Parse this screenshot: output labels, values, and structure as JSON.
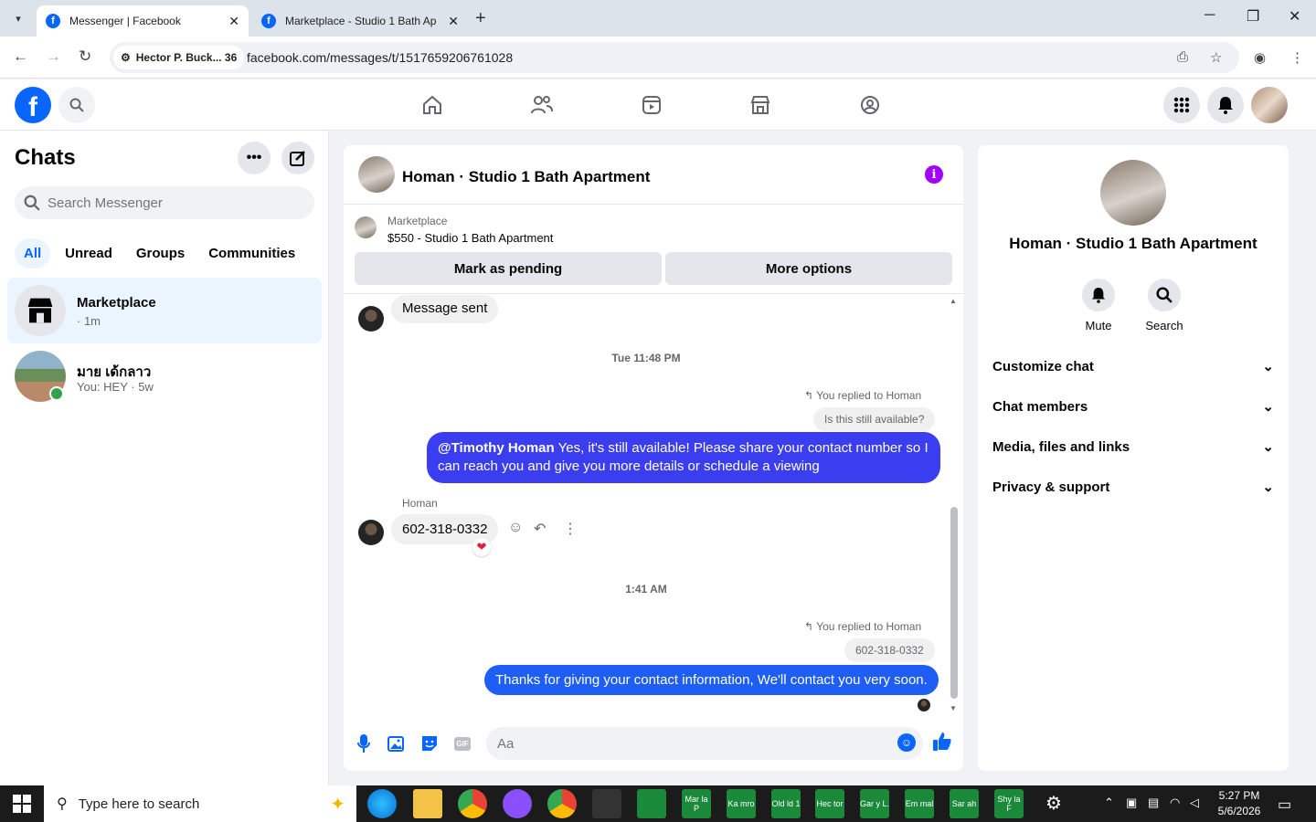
{
  "browser": {
    "tabs": [
      {
        "title": "Messenger | Facebook",
        "active": true
      },
      {
        "title": "Marketplace - Studio 1 Bath Ap",
        "active": false
      }
    ],
    "site_chip": "Hector P. Buck... 36",
    "url": "facebook.com/messages/t/1517659206761028"
  },
  "chats": {
    "title": "Chats",
    "search_placeholder": "Search Messenger",
    "filters": [
      "All",
      "Unread",
      "Groups",
      "Communities"
    ],
    "items": [
      {
        "name": "Marketplace",
        "sub": "· 1m"
      },
      {
        "name": "มาย เด้กลาว",
        "sub": "You: HEY · 5w"
      }
    ]
  },
  "conversation": {
    "title": "Homan · Studio 1 Bath Apartment",
    "marketplace_label": "Marketplace",
    "listing": "$550 - Studio 1 Bath Apartment",
    "btn_pending": "Mark as pending",
    "btn_more": "More options",
    "messages": {
      "msg1": "Message sent",
      "stamp1": "Tue 11:48 PM",
      "replied1": "You replied to Homan",
      "quote1": "Is this still available?",
      "reply1_mention": "@Timothy Homan",
      "reply1_text": " Yes, it's still available! Please share your contact number so I can reach you and give you more details or schedule a viewing",
      "sender": "Homan",
      "phone": "602-318-0332",
      "stamp2": "1:41 AM",
      "replied2": "You replied to Homan",
      "quote2": "602-318-0332",
      "reply2": "Thanks for giving your contact information, We'll contact you very soon."
    },
    "composer_placeholder": "Aa"
  },
  "info_panel": {
    "name": "Homan · Studio 1 Bath Apartment",
    "actions": [
      "Mute",
      "Search"
    ],
    "sections": [
      "Customize chat",
      "Chat members",
      "Media, files and links",
      "Privacy & support"
    ]
  },
  "taskbar": {
    "search_placeholder": "Type here to search",
    "apps": [
      "Mar la P",
      "Ka mro",
      "Old ld 1",
      "Hec tor",
      "Gar y L.",
      "Em mal",
      "Sar ah",
      "Shy la F"
    ],
    "time": "5:27 PM",
    "date": "5/6/2026"
  },
  "colors": {
    "brand": "#0866ff",
    "bubble_out": "#3b3ef0",
    "info": "#a200ff"
  }
}
